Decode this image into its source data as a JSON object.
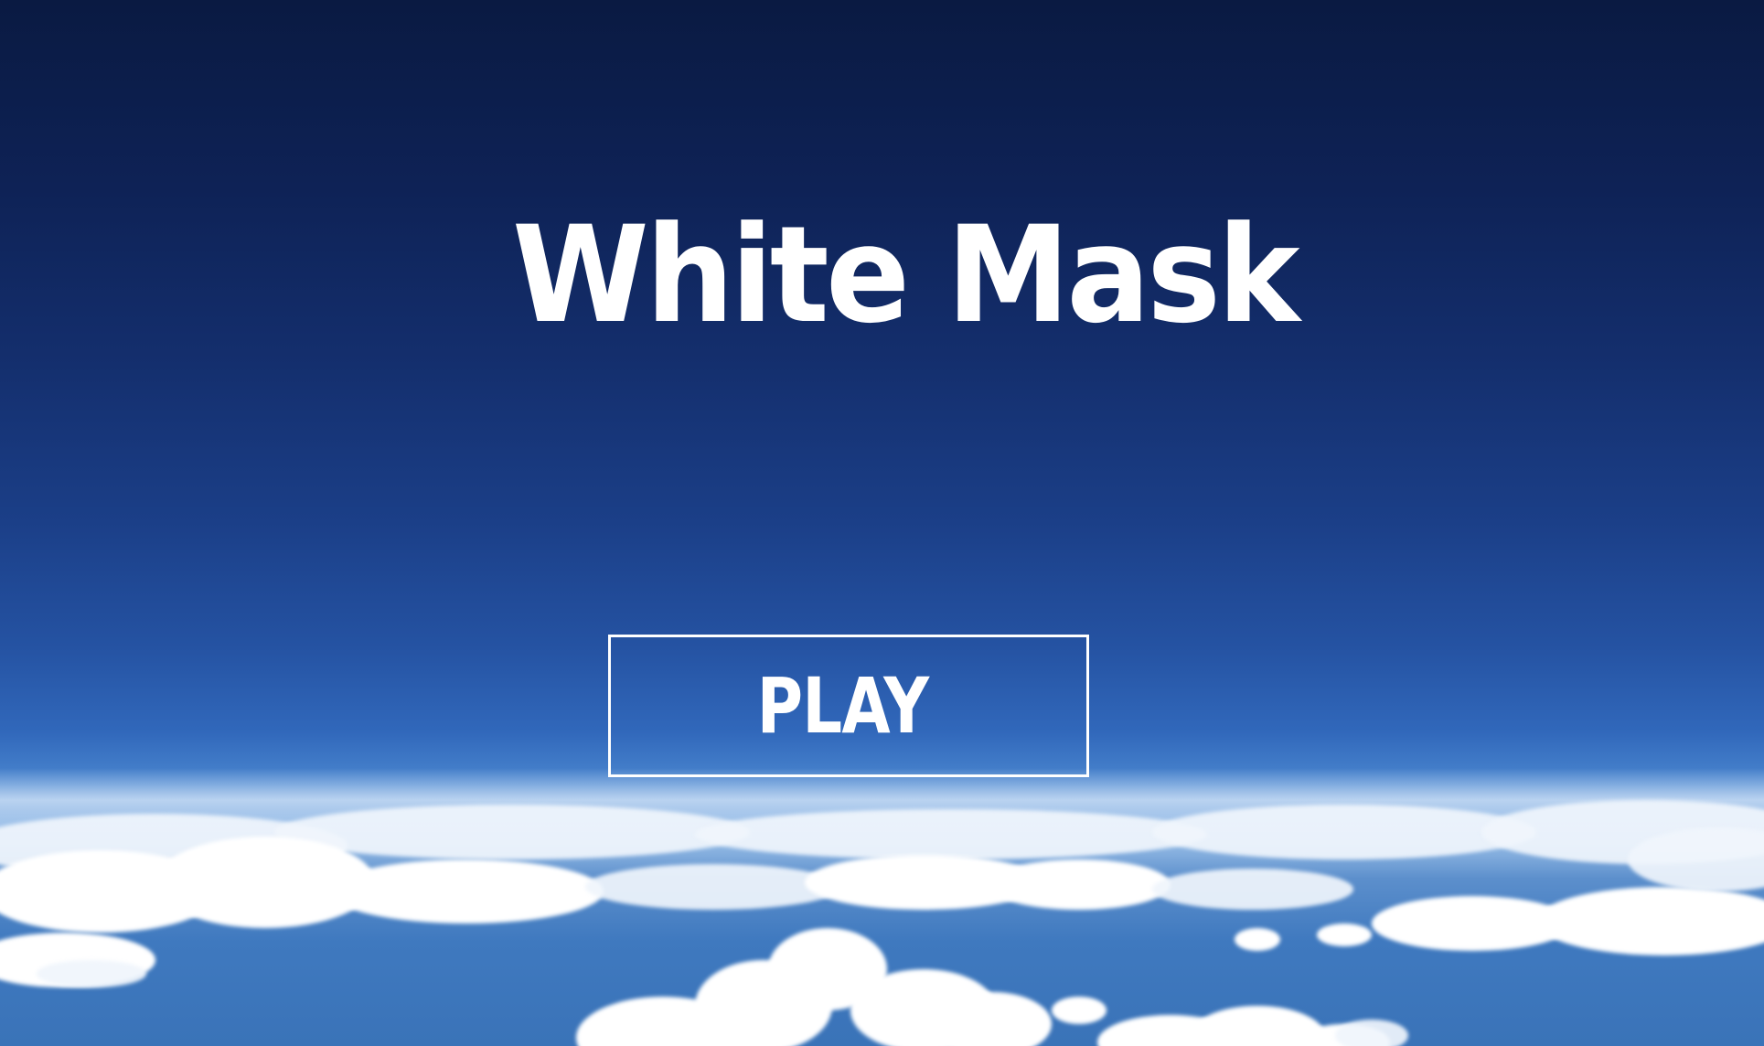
{
  "game": {
    "title": "White Mask",
    "play_label": "PLAY"
  },
  "colors": {
    "sky_top": "#0a1a42",
    "sky_horizon": "#9fc3ea",
    "text": "#ffffff"
  }
}
